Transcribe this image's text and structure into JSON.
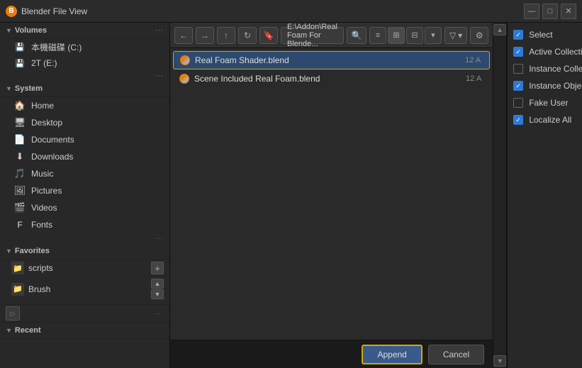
{
  "window": {
    "title": "Blender File View",
    "icon": "B"
  },
  "titlebar_controls": {
    "minimize": "—",
    "maximize": "□",
    "close": "✕"
  },
  "toolbar": {
    "back": "←",
    "forward": "→",
    "up": "↑",
    "refresh": "↻",
    "bookmark": "🔖",
    "path": "E:\\Addon\\Real Foam For Blende...",
    "search_icon": "🔍",
    "filter_icon": "▽",
    "settings_icon": "⚙"
  },
  "files": [
    {
      "name": "Real Foam Shader.blend",
      "size": "12 A",
      "selected": true
    },
    {
      "name": "Scene Included Real Foam.blend",
      "size": "12 A",
      "selected": false
    }
  ],
  "sidebar": {
    "volumes_label": "Volumes",
    "volumes_items": [
      {
        "label": "本機磁碟 (C:)",
        "icon": "💾"
      },
      {
        "label": "2T (E:)",
        "icon": "💾"
      }
    ],
    "system_label": "System",
    "system_items": [
      {
        "label": "Home",
        "icon": "🏠"
      },
      {
        "label": "Desktop",
        "icon": "🖥"
      },
      {
        "label": "Documents",
        "icon": "📄"
      },
      {
        "label": "Downloads",
        "icon": "⬇"
      },
      {
        "label": "Music",
        "icon": "🎵"
      },
      {
        "label": "Pictures",
        "icon": "🖼"
      },
      {
        "label": "Videos",
        "icon": "🎬"
      },
      {
        "label": "Fonts",
        "icon": "F"
      }
    ],
    "favorites_label": "Favorites",
    "favorites_items": [
      {
        "label": "scripts",
        "icon": "📁"
      },
      {
        "label": "Brush",
        "icon": "📁"
      }
    ],
    "recent_label": "Recent"
  },
  "right_panel": {
    "checkboxes": [
      {
        "label": "Select",
        "checked": true
      },
      {
        "label": "Active Collection",
        "checked": true
      },
      {
        "label": "Instance Collections",
        "checked": false
      },
      {
        "label": "Instance Object Data",
        "checked": true
      },
      {
        "label": "Fake User",
        "checked": false
      },
      {
        "label": "Localize All",
        "checked": true
      }
    ]
  },
  "bottom": {
    "append_label": "Append",
    "cancel_label": "Cancel"
  }
}
